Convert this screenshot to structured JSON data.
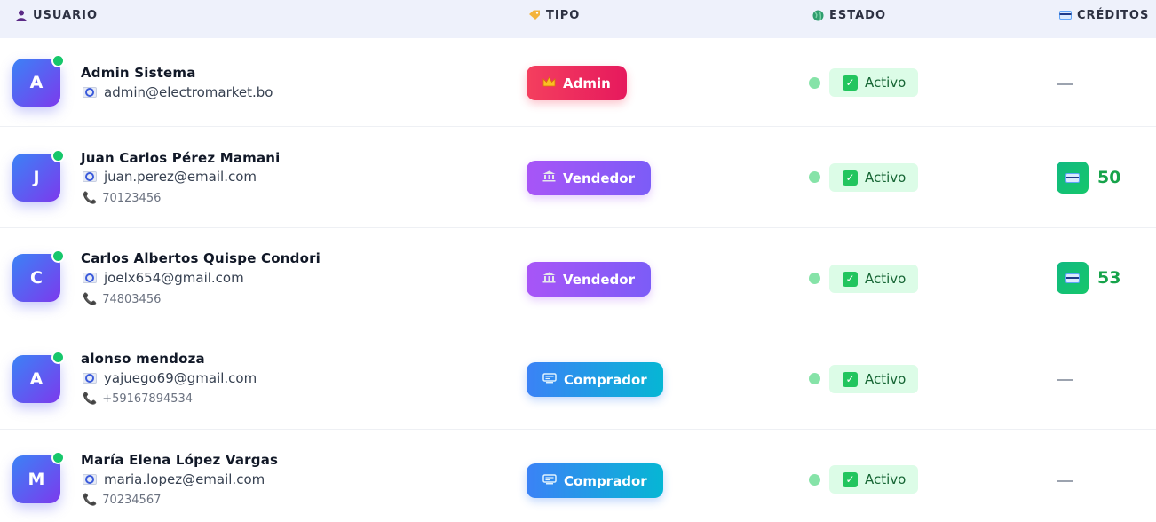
{
  "header": {
    "usuario": "USUARIO",
    "tipo": "TIPO",
    "estado": "ESTADO",
    "creditos": "CRÉDITOS"
  },
  "icons": {
    "usuario": "user-icon",
    "tipo": "tag-icon",
    "estado": "globe-icon",
    "creditos": "card-icon",
    "email": "mail-icon",
    "phone": "phone-icon",
    "status": "check-icon",
    "admin": "crown-icon",
    "vendedor": "bank-icon",
    "comprador": "cart-icon"
  },
  "colors": {
    "admin": "#f43f5e",
    "vendedor": "#a855f7",
    "comprador": "#3b82f6",
    "active": "#22c55e",
    "credits": "#16a34a",
    "online": "#16c76b"
  },
  "users": [
    {
      "initial": "A",
      "name": "Admin Sistema",
      "email": "admin@electromarket.bo",
      "phone": "",
      "type": "Admin",
      "status": "Activo",
      "credits": "—"
    },
    {
      "initial": "J",
      "name": "Juan Carlos Pérez Mamani",
      "email": "juan.perez@email.com",
      "phone": "70123456",
      "type": "Vendedor",
      "status": "Activo",
      "credits": "50"
    },
    {
      "initial": "C",
      "name": "Carlos Albertos Quispe Condori",
      "email": "joelx654@gmail.com",
      "phone": "74803456",
      "type": "Vendedor",
      "status": "Activo",
      "credits": "53"
    },
    {
      "initial": "A",
      "name": "alonso mendoza",
      "email": "yajuego69@gmail.com",
      "phone": "+59167894534",
      "type": "Comprador",
      "status": "Activo",
      "credits": "—"
    },
    {
      "initial": "M",
      "name": "María Elena López Vargas",
      "email": "maria.lopez@email.com",
      "phone": "70234567",
      "type": "Comprador",
      "status": "Activo",
      "credits": "—"
    }
  ]
}
